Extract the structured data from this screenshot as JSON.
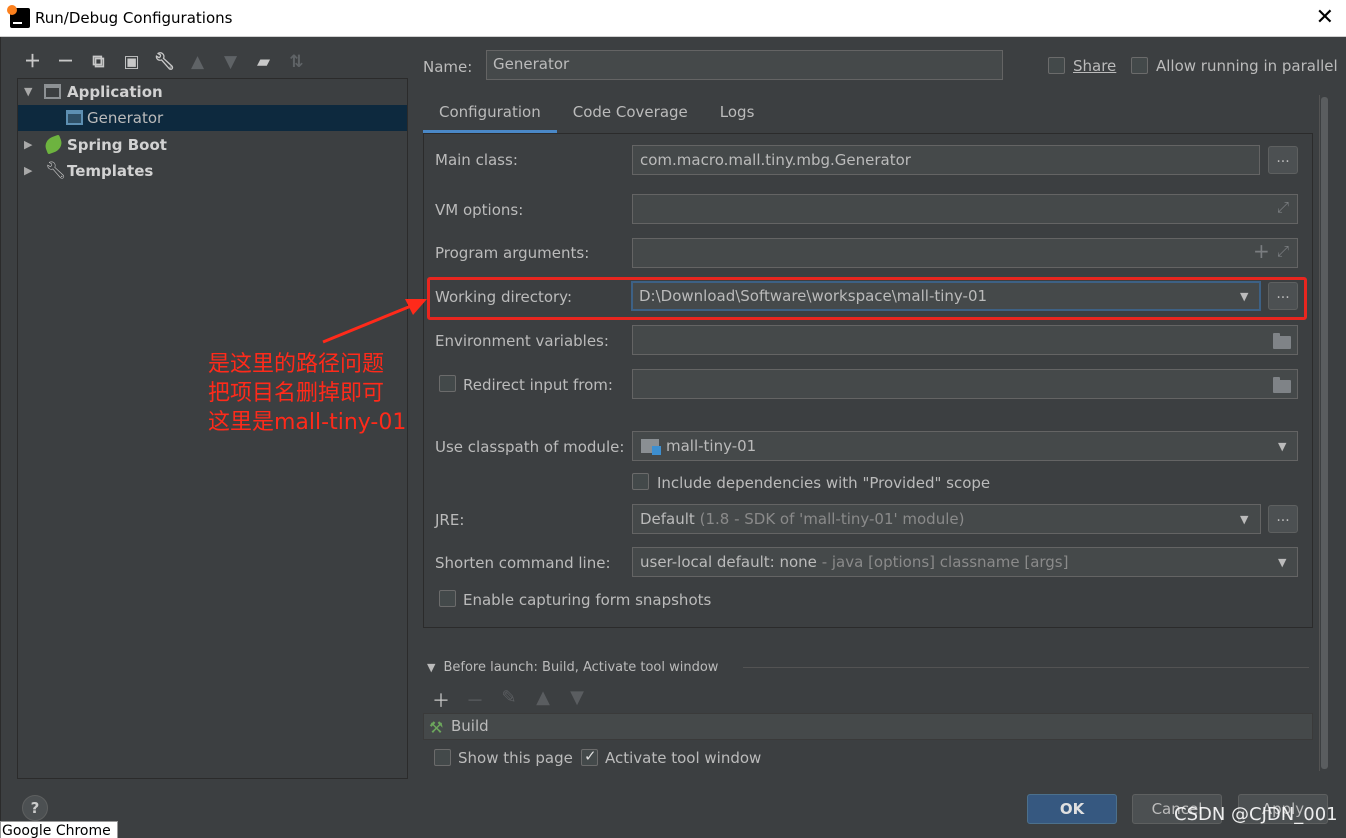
{
  "window": {
    "title": "Run/Debug Configurations",
    "close_glyph": "✕"
  },
  "toolbar": {
    "icons": [
      "add-icon",
      "remove-icon",
      "copy-icon",
      "save-icon",
      "wrench-icon",
      "move-up-icon",
      "move-down-icon",
      "folder-add-icon",
      "sort-icon"
    ]
  },
  "tree": {
    "items": [
      {
        "label": "Application",
        "expanded": true,
        "icon": "application-icon"
      },
      {
        "label": "Generator",
        "selected": true,
        "icon": "generator-icon"
      },
      {
        "label": "Spring Boot",
        "expanded": false,
        "icon": "spring-boot-icon"
      },
      {
        "label": "Templates",
        "expanded": false,
        "icon": "wrench-icon"
      }
    ]
  },
  "header": {
    "name_label": "Name:",
    "name_value": "Generator",
    "share_label": "Share",
    "parallel_label": "Allow running in parallel"
  },
  "tabs": [
    {
      "label": "Configuration",
      "active": true
    },
    {
      "label": "Code Coverage",
      "active": false
    },
    {
      "label": "Logs",
      "active": false
    }
  ],
  "form": {
    "main_class_label": "Main class:",
    "main_class_value": "com.macro.mall.tiny.mbg.Generator",
    "vm_options_label": "VM options:",
    "program_args_label": "Program arguments:",
    "working_dir_label": "Working directory:",
    "working_dir_value": "D:\\Download\\Software\\workspace\\mall-tiny-01",
    "env_vars_label": "Environment variables:",
    "redirect_label": "Redirect input from:",
    "classpath_label": "Use classpath of module:",
    "classpath_value": "mall-tiny-01",
    "include_deps_label": "Include dependencies with \"Provided\" scope",
    "jre_label": "JRE:",
    "jre_value_main": "Default",
    "jre_value_dim": "(1.8 - SDK of 'mall-tiny-01' module)",
    "shorten_label": "Shorten command line:",
    "shorten_value_main": "user-local default: none",
    "shorten_value_dim": "- java [options] classname [args]",
    "snapshots_label": "Enable capturing form snapshots",
    "browse": "..."
  },
  "annotation": {
    "lines": [
      "是这里的路径问题",
      "把项目名删掉即可",
      "这里是mall-tiny-01"
    ],
    "color": "#ff2a1a"
  },
  "before_launch": {
    "title": "Before launch: Build, Activate tool window",
    "build_label": "Build",
    "show_page_label": "Show this page",
    "activate_label": "Activate tool window"
  },
  "footer": {
    "help": "?",
    "ok": "OK",
    "cancel": "Cancel",
    "apply": "Apply"
  },
  "overlay": {
    "chrome_tip": "Google Chrome",
    "watermark": "CSDN @CJDN_001"
  }
}
